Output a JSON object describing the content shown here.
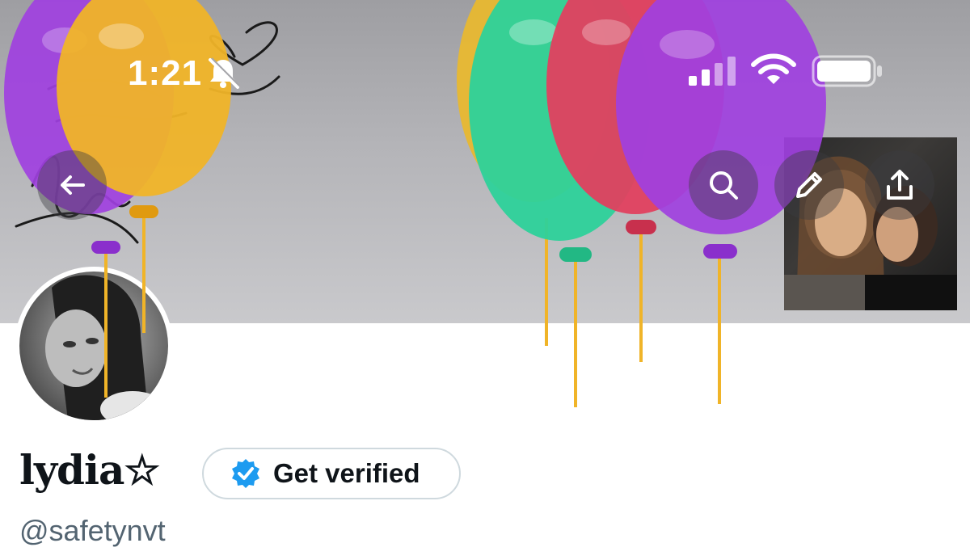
{
  "status_bar": {
    "time": "1:21",
    "icons": [
      "bell-slash-icon",
      "cellular-signal-icon",
      "wifi-icon",
      "battery-icon"
    ]
  },
  "header": {
    "buttons": [
      "back-arrow-icon",
      "search-icon",
      "pencil-icon",
      "share-icon"
    ]
  },
  "balloon_colors": [
    "#a040e0",
    "#f0b428",
    "#e8b830",
    "#2dd19a",
    "#e0405f",
    "#a040e0"
  ],
  "profile": {
    "display_name": "lydia☆",
    "handle": "@safetynvt",
    "verify_button_label": "Get verified",
    "verify_badge_color": "#1d9bf0"
  },
  "colors": {
    "name": "#0f1419",
    "handle": "#536471",
    "button_border": "#cfd9de"
  }
}
